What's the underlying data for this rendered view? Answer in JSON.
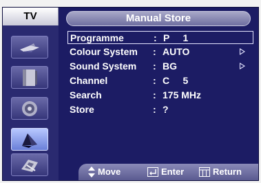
{
  "sidebar": {
    "title": "TV",
    "icons": [
      {
        "name": "picture-icon",
        "active": false
      },
      {
        "name": "sound-icon",
        "active": false
      },
      {
        "name": "channel-icon",
        "active": false
      },
      {
        "name": "setup-icon",
        "active": true
      },
      {
        "name": "input-icon",
        "active": false
      }
    ]
  },
  "header": {
    "title": "Manual Store"
  },
  "menu": {
    "rows": [
      {
        "label": "Programme",
        "colon": ":",
        "value": "P     1",
        "arrow": false,
        "selected": true
      },
      {
        "label": "Colour System",
        "colon": ":",
        "value": "AUTO",
        "arrow": true,
        "selected": false
      },
      {
        "label": "Sound System",
        "colon": ":",
        "value": "BG",
        "arrow": true,
        "selected": false
      },
      {
        "label": "Channel",
        "colon": ":",
        "value": "C     5",
        "arrow": false,
        "selected": false
      },
      {
        "label": "Search",
        "colon": ":",
        "value": "175 MHz",
        "arrow": false,
        "selected": false
      },
      {
        "label": "Store",
        "colon": ":",
        "value": "?",
        "arrow": false,
        "selected": false
      }
    ]
  },
  "footer": {
    "move": {
      "icon": "up-down-arrow-icon",
      "label": "Move"
    },
    "enter": {
      "icon": "enter-icon",
      "label": "Enter"
    },
    "return": {
      "icon": "return-icon",
      "label": "Return"
    }
  },
  "colors": {
    "background": "#1c1c64",
    "sidebar": "#2a2a70",
    "text": "#ffffff",
    "active_icon": "#8a9ee8"
  }
}
